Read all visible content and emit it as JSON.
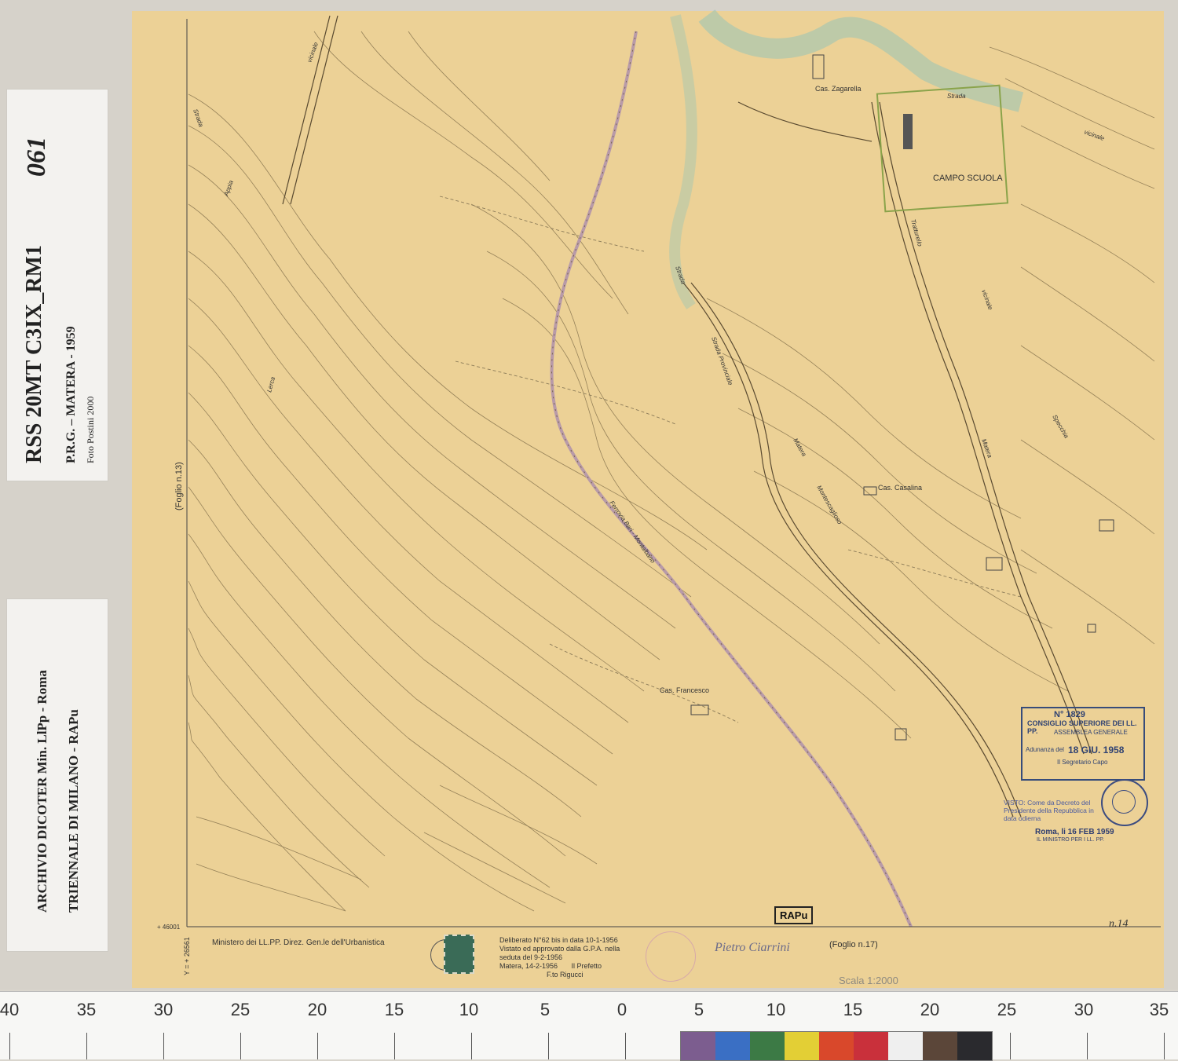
{
  "label_card_top": {
    "code": "RSS 20MT C3IX_RM1",
    "number": "061",
    "plan": "P.R.G. – MATERA - 1959",
    "photo_credit": "Foto Postini 2000"
  },
  "label_card_bottom": {
    "archive": "ARCHIVIO DICOTER Min. LlPp - Roma",
    "triennale": "TRIENNALE DI MILANO - RAPu"
  },
  "map": {
    "place_labels": [
      "Cas. Zagarella",
      "CAMPO SCUOLA",
      "Cas. Casalina",
      "Cas. Francesco"
    ],
    "road_labels": [
      "Strada",
      "vicinale",
      "Strada",
      "Ferrovia Bari - Montalbano",
      "Strada Provinciale",
      "Matera",
      "Montescaglioso",
      "Tratturello",
      "vicinale",
      "Matera",
      "Specchia",
      "Strada",
      "vicinale",
      "Lerca",
      "Appia"
    ],
    "sheet_ref_left": "(Foglio n.13)",
    "sheet_ref_bottom": "(Foglio n.17)",
    "sheet_number": "n.14",
    "rapu_mark": "RAPu",
    "ministry_line": "Ministero dei LL.PP. Direz. Gen.le dell'Urbanistica",
    "deliberation": "Deliberato N°62 bis in data 10-1-1956\nVistato ed approvato dalla G.P.A. nella\nseduta del 9-2-1956\nMatera, 14-2-1956       Il Prefetto\n                        F.to Rigucci",
    "scale": "Scala 1:2000",
    "signature": "Pietro Ciarrini",
    "coord_y": "Y = + 26561",
    "coord_x": "+ 46001"
  },
  "stamp": {
    "number": "N° 1829",
    "title": "CONSIGLIO SUPERIORE DEI LL. PP.",
    "subtitle": "ASSEMBLEA GENERALE",
    "adunanza": "Adunanza del",
    "date": "18 GIU. 1958",
    "secretary": "Il Segretario Capo"
  },
  "visto": {
    "text": "VISTO: Come da Decreto del Presidente della Repubblica in data odierna",
    "date": "Roma, li 16 FEB 1959",
    "minister": "IL MINISTRO PER I LL. PP."
  },
  "ruler": {
    "numbers": [
      "40",
      "35",
      "30",
      "25",
      "20",
      "15",
      "10",
      "5",
      "0",
      "5",
      "10",
      "15",
      "20",
      "25",
      "30",
      "35"
    ]
  },
  "color_swatches": [
    "#7c5d8f",
    "#3a6fc4",
    "#3c7a45",
    "#e3cf35",
    "#d9482b",
    "#c9303b",
    "#efefef",
    "#5b4639",
    "#2a2a2e"
  ],
  "colors": {
    "paper": "#ecd196",
    "contour": "#6b5a3c",
    "railway": "#b89aa8",
    "river": "#9fc5b4",
    "stamp_ink": "#374c7a"
  }
}
